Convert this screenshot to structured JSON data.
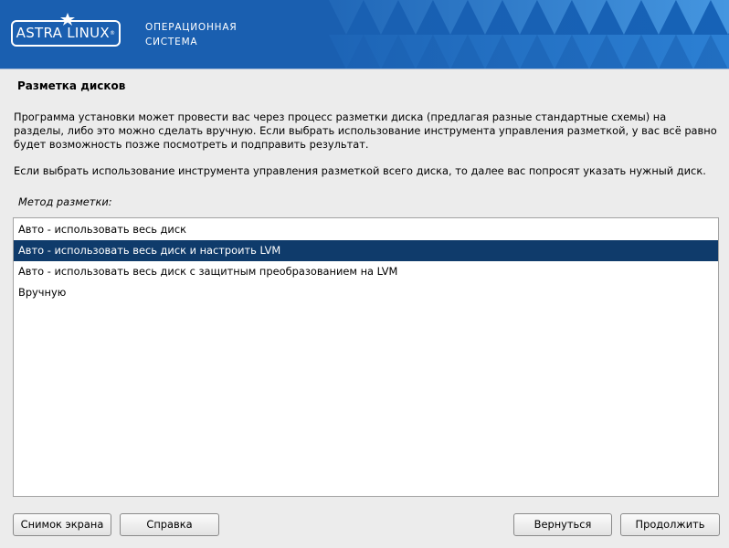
{
  "header": {
    "logo_text": "ASTRA LINUX",
    "logo_mark": "®",
    "tagline_line1": "ОПЕРАЦИОННАЯ",
    "tagline_line2": "СИСТЕМА",
    "banner_color": "#1a5fb0"
  },
  "page": {
    "title": "Разметка дисков",
    "paragraph1": "Программа установки может провести вас через процесс разметки диска (предлагая разные стандартные схемы) на разделы, либо это можно сделать вручную. Если выбрать использование инструмента управления разметкой, у вас всё равно будет возможность позже посмотреть и подправить результат.",
    "paragraph2": "Если выбрать использование инструмента управления разметкой всего диска, то далее вас попросят указать нужный диск.",
    "method_label": "Метод разметки:"
  },
  "methods": {
    "items": [
      "Авто - использовать весь диск",
      "Авто - использовать весь диск и настроить LVM",
      "Авто - использовать весь диск с защитным преобразованием на LVM",
      "Вручную"
    ],
    "selected_index": 1,
    "selected_color": "#0f3b6b"
  },
  "buttons": {
    "screenshot": "Снимок экрана",
    "help": "Справка",
    "back": "Вернуться",
    "continue": "Продолжить"
  }
}
